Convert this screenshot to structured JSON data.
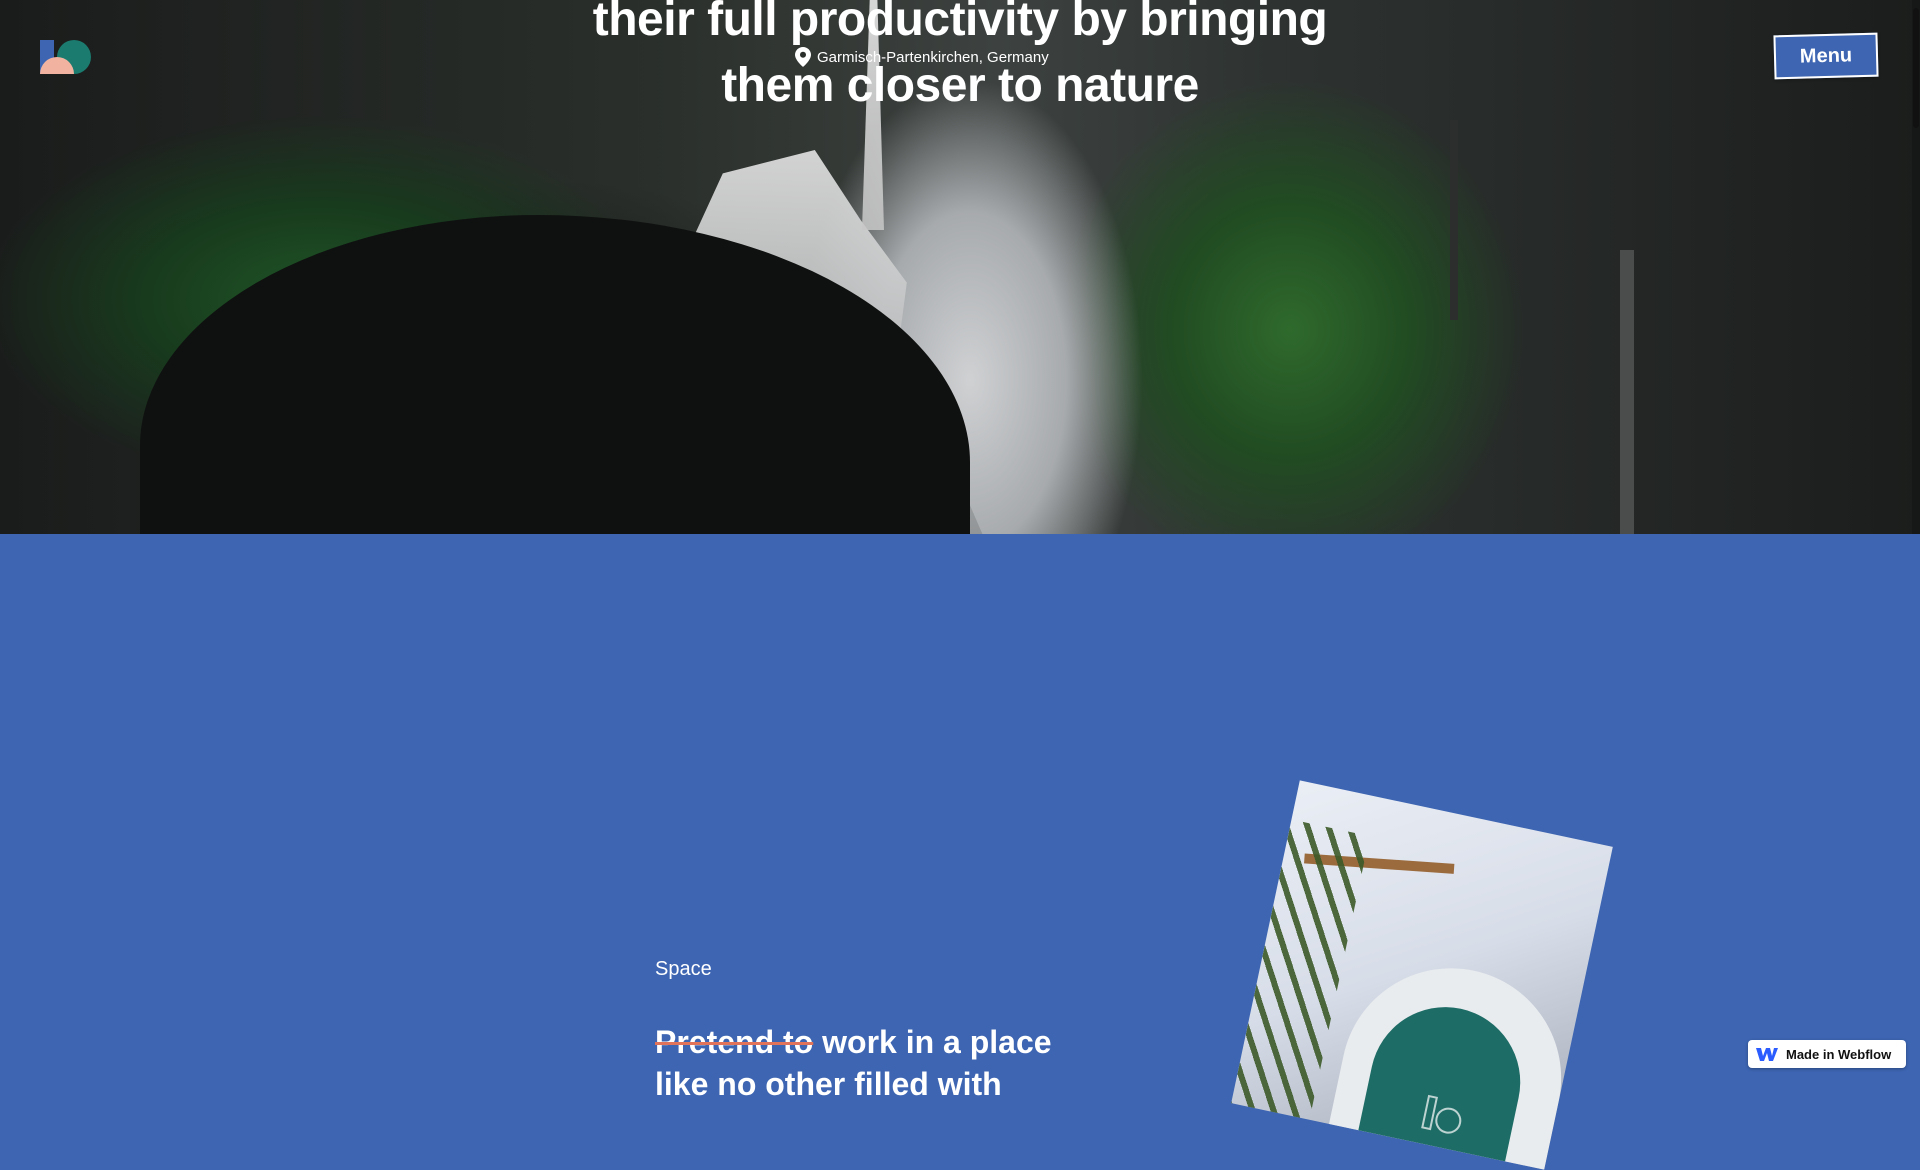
{
  "hero": {
    "title_line1": "their full productivity by bringing",
    "title_line2": "them closer to nature",
    "location": "Garmisch-Partenkirchen, Germany"
  },
  "header": {
    "menu_label": "Menu"
  },
  "space_section": {
    "label": "Space",
    "headline_strike": "Pretend to",
    "headline_rest": " work in a place",
    "headline_next": "like no other filled with"
  },
  "badge": {
    "label": "Made in Webflow"
  },
  "colors": {
    "accent_blue": "#3d65b2",
    "logo_teal": "#1b7b6f",
    "logo_peach": "#f1b3a0",
    "strike_red": "#e0735a"
  },
  "icons": [
    "logo-icon",
    "pin-icon",
    "webflow-icon"
  ]
}
